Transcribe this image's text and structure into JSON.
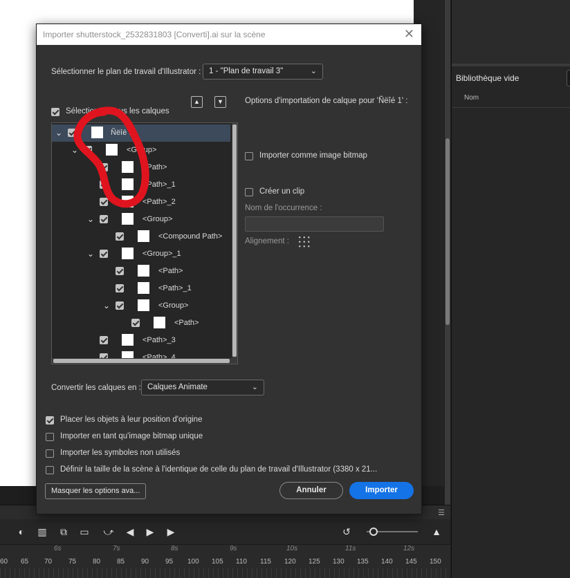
{
  "dialog": {
    "title": "Importer shutterstock_2532831803 [Converti].ai sur la scène",
    "close_glyph": "✕",
    "artboard_label": "Sélectionner le plan de travail d'Illustrator :",
    "artboard_value": "1 - \"Plan de travail 3\"",
    "select_all_label": "Sélectionner tous les calques",
    "layer_options_title": "Options d'importation de calque pour 'Ñëîé 1' :",
    "import_bitmap_label": "Importer comme image bitmap",
    "create_clip_label": "Créer un clip",
    "instance_name_label": "Nom de l'occurrence :",
    "alignment_label": "Alignement :",
    "convert_label": "Convertir les calques en :",
    "convert_value": "Calques Animate",
    "options": [
      {
        "label": "Placer les objets à leur position d'origine",
        "checked": true
      },
      {
        "label": "Importer en tant qu'image bitmap unique",
        "checked": false
      },
      {
        "label": "Importer les symboles non utilisés",
        "checked": false
      },
      {
        "label": "Définir la taille de la scène à l'identique de celle du plan de travail d'Illustrator (3380 x 21...",
        "checked": false
      }
    ],
    "hide_options_button": "Masquer les options ava...",
    "cancel_button": "Annuler",
    "import_button": "Importer"
  },
  "tree": {
    "rows": [
      {
        "label": "Ñëîé 1",
        "indent": 0,
        "expanded": true,
        "selected": true
      },
      {
        "label": "<Group>",
        "indent": 1,
        "expanded": true
      },
      {
        "label": "<Path>",
        "indent": 2
      },
      {
        "label": "<Path>_1",
        "indent": 2
      },
      {
        "label": "<Path>_2",
        "indent": 2
      },
      {
        "label": "<Group>",
        "indent": 2,
        "expanded": true
      },
      {
        "label": "<Compound Path>",
        "indent": 3
      },
      {
        "label": "<Group>_1",
        "indent": 2,
        "expanded": true
      },
      {
        "label": "<Path>",
        "indent": 3
      },
      {
        "label": "<Path>_1",
        "indent": 3
      },
      {
        "label": "<Group>",
        "indent": 3,
        "expanded": true
      },
      {
        "label": "<Path>",
        "indent": 4
      },
      {
        "label": "<Path>_3",
        "indent": 2
      },
      {
        "label": "<Path>_4",
        "indent": 2
      }
    ]
  },
  "library": {
    "title": "Bibliothèque vide",
    "column_name": "Nom"
  },
  "timeline": {
    "seconds": [
      "6s",
      "7s",
      "8s",
      "9s",
      "10s",
      "11s",
      "12s"
    ],
    "frames": [
      "60",
      "65",
      "70",
      "75",
      "80",
      "85",
      "90",
      "95",
      "100",
      "105",
      "110",
      "115",
      "120",
      "125",
      "130",
      "135",
      "140",
      "145",
      "150"
    ]
  },
  "colors": {
    "primary": "#1473e6",
    "annotation": "#e0141e"
  }
}
